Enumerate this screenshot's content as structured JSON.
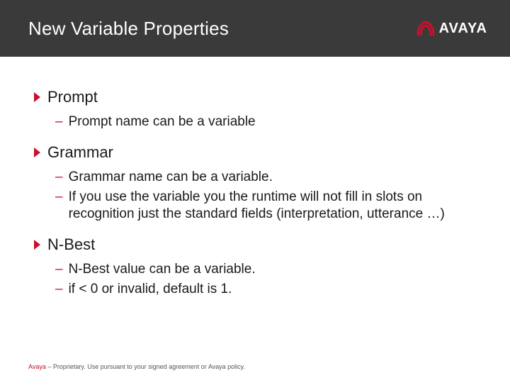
{
  "brand": {
    "name": "AVAYA"
  },
  "title": "New Variable Properties",
  "bullets": [
    {
      "label": "Prompt",
      "subs": [
        "Prompt name can be a variable"
      ]
    },
    {
      "label": "Grammar",
      "subs": [
        "Grammar name can be a variable.",
        "If you use the variable you the runtime will not fill in slots on recognition just the standard fields (interpretation, utterance …)"
      ]
    },
    {
      "label": "N-Best",
      "subs": [
        "N-Best value can be a variable.",
        "if < 0 or invalid, default is 1."
      ]
    }
  ],
  "footer": {
    "brand": "Avaya",
    "rest": " – Proprietary. Use pursuant to your signed agreement or Avaya policy."
  }
}
